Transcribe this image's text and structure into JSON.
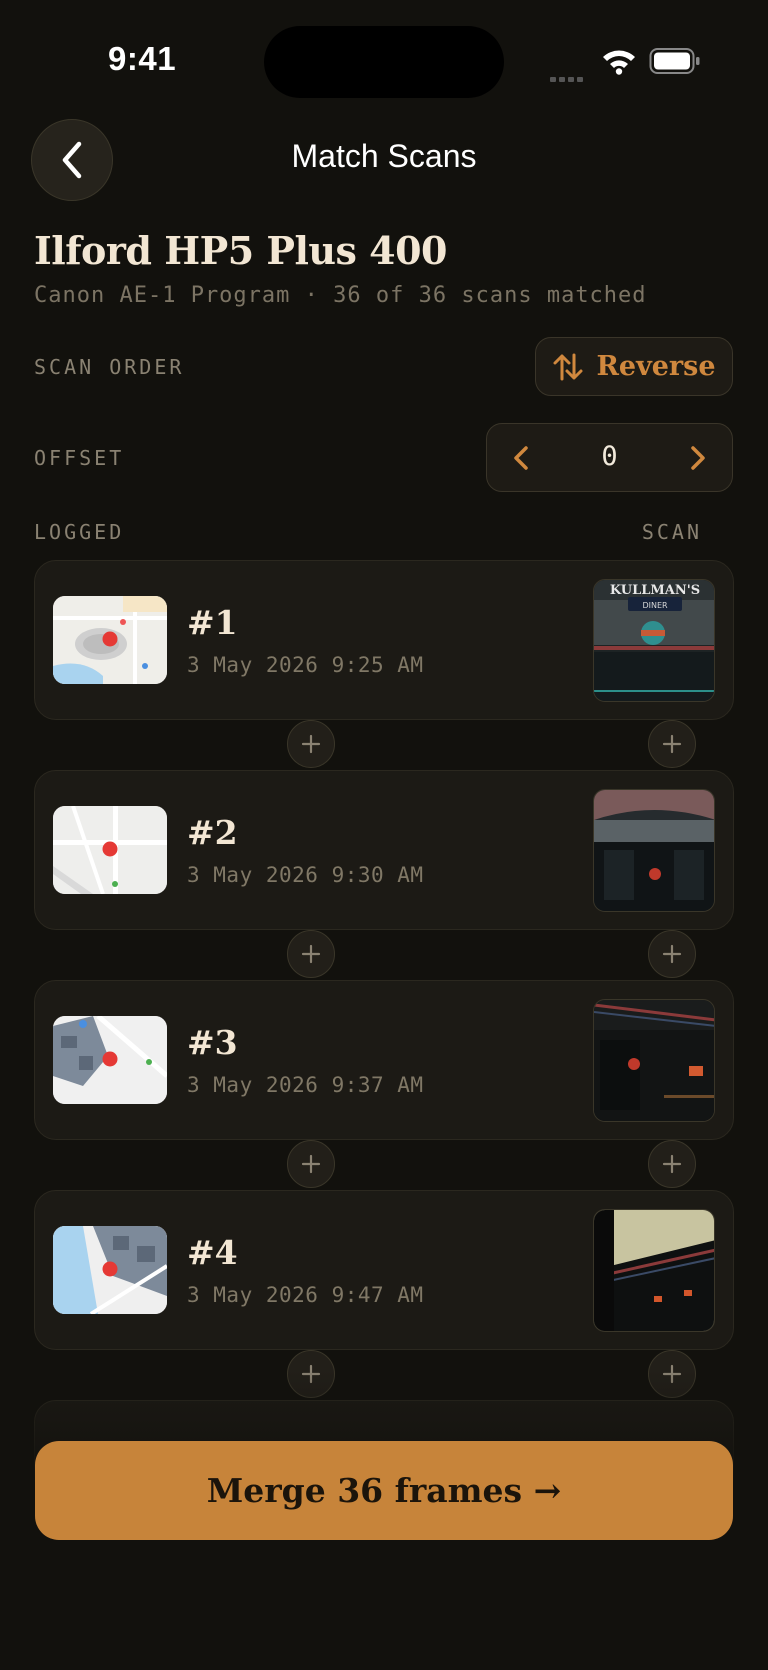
{
  "status_bar": {
    "time": "9:41"
  },
  "nav": {
    "title": "Match Scans"
  },
  "roll": {
    "title": "Ilford HP5 Plus 400",
    "subtitle": "Canon AE-1 Program · 36 of 36 scans matched"
  },
  "scan_order": {
    "label": "SCAN ORDER",
    "button_label": "Reverse"
  },
  "offset": {
    "label": "OFFSET",
    "value": "0"
  },
  "columns": {
    "logged": "LOGGED",
    "scan": "SCAN"
  },
  "frames": [
    {
      "number": "#1",
      "date": "3 May 2026 9:25 AM",
      "scan_sign": "KULLMAN'S",
      "scan_sub": "DINER"
    },
    {
      "number": "#2",
      "date": "3 May 2026 9:30 AM"
    },
    {
      "number": "#3",
      "date": "3 May 2026 9:37 AM"
    },
    {
      "number": "#4",
      "date": "3 May 2026 9:47 AM"
    }
  ],
  "merge_button": {
    "label": "Merge 36 frames →"
  },
  "colors": {
    "accent": "#c7843a",
    "background": "#12110d",
    "card": "#1c1a15",
    "pin": "#e53935"
  }
}
